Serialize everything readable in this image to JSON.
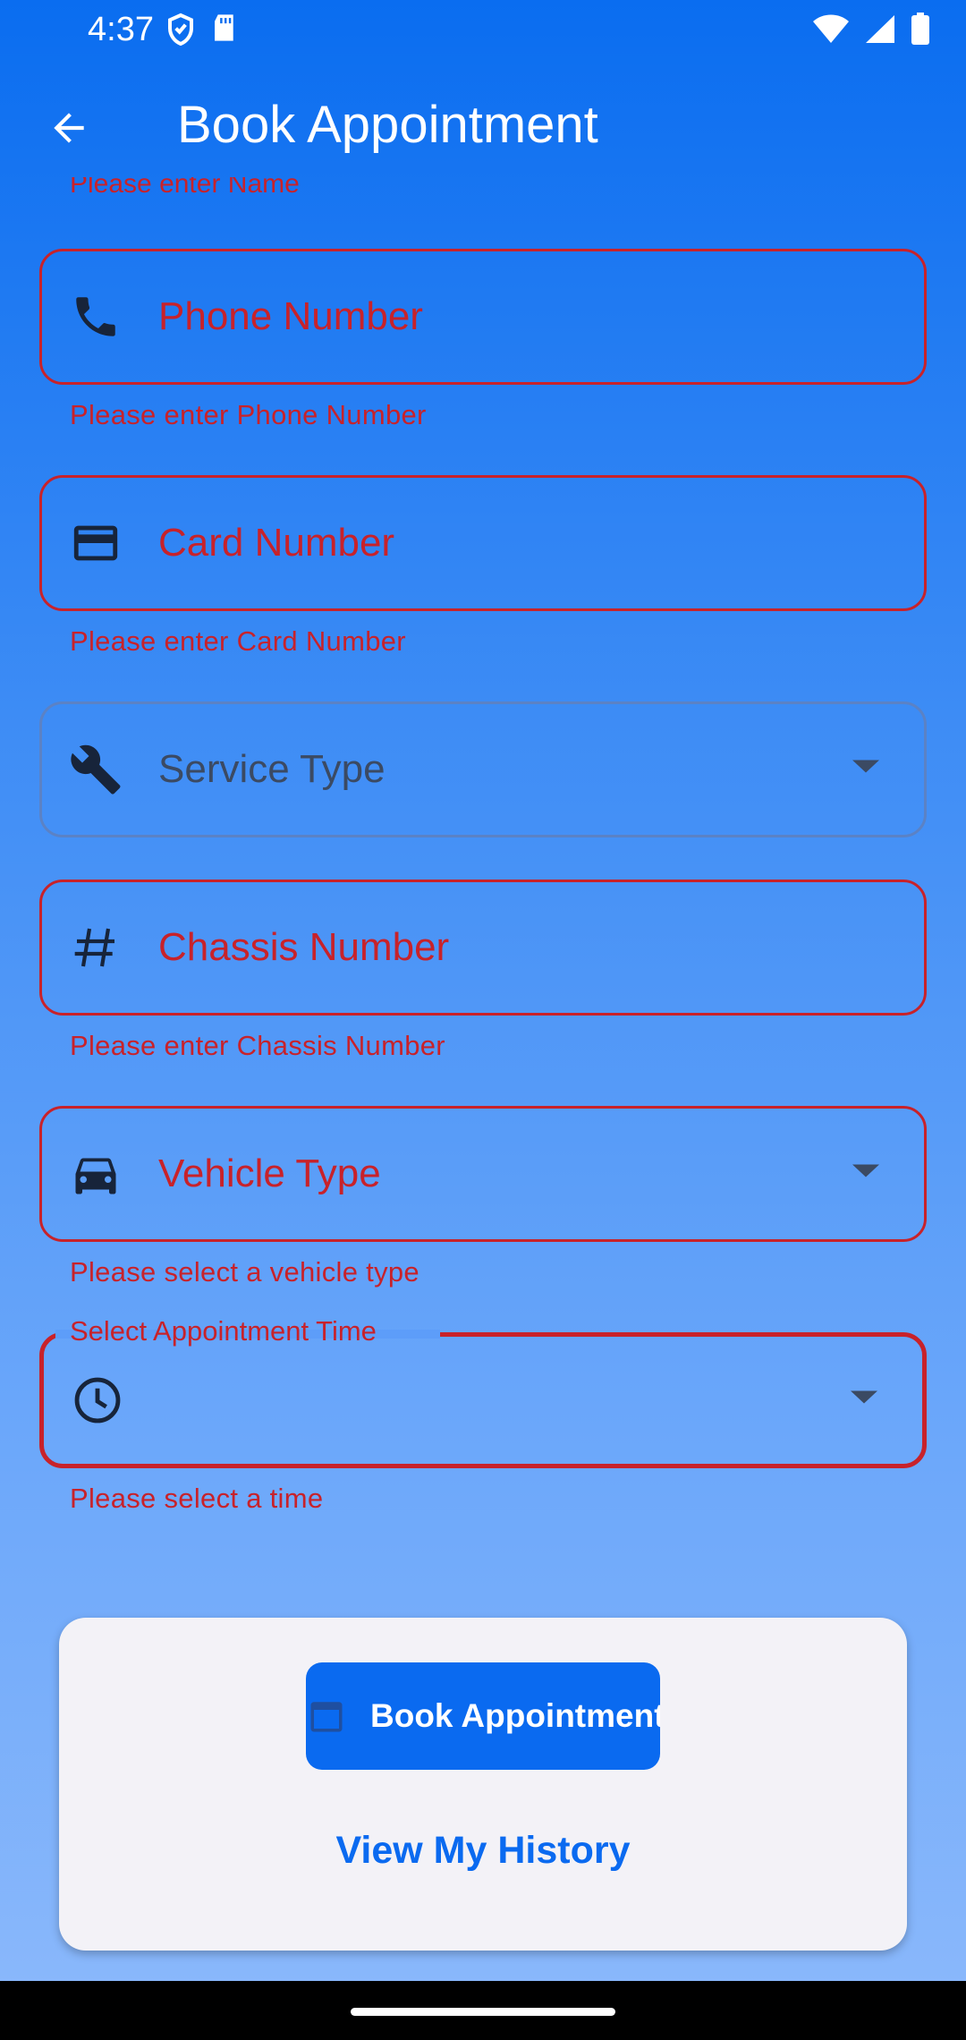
{
  "status_bar": {
    "time": "4:37",
    "icons_left": [
      "shield-icon",
      "sd-card-icon"
    ],
    "icons_right": [
      "wifi-icon",
      "signal-icon",
      "battery-icon"
    ]
  },
  "app_bar": {
    "title": "Book Appointment",
    "back_icon": "arrow-back-icon"
  },
  "cut_off_error": "Please enter Name",
  "fields": {
    "phone": {
      "label": "Phone Number",
      "icon": "phone-icon",
      "error": "Please enter Phone Number"
    },
    "card": {
      "label": "Card Number",
      "icon": "credit-card-icon",
      "error": "Please enter Card Number"
    },
    "service": {
      "label": "Service Type",
      "icon": "wrench-icon"
    },
    "chassis": {
      "label": "Chassis Number",
      "icon": "hash-icon",
      "error": "Please enter Chassis Number"
    },
    "vehicle": {
      "label": "Vehicle Type",
      "icon": "car-icon",
      "error": "Please select a vehicle type"
    },
    "time": {
      "label": "Select Appointment Time",
      "icon": "clock-icon",
      "value": "",
      "error": "Please select a time"
    }
  },
  "actions": {
    "book_label": "Book Appointment",
    "book_icon": "calendar-icon",
    "history_label": "View My History"
  },
  "colors": {
    "primary": "#0A6AF0",
    "error": "#C8222A",
    "card_bg": "#F3F2F7"
  }
}
